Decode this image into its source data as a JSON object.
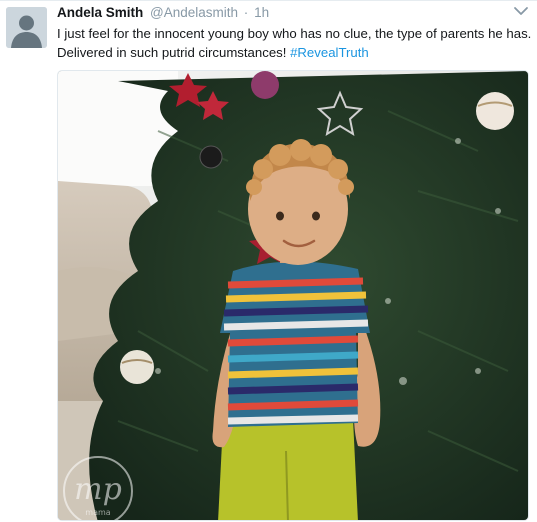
{
  "tweet": {
    "author_name": "Andela Smith",
    "handle": "@Andelasmith",
    "separator": "·",
    "time": "1h",
    "text_before": "I just feel for the innocent young boy who has no clue, the type of parents he has. Delivered in such putrid circumstances! ",
    "hashtag": "#RevealTruth"
  },
  "watermark": {
    "text_main": "mp",
    "text_sub": "mama"
  },
  "icons": {
    "avatar": "default-avatar-icon",
    "caret": "chevron-down-icon"
  },
  "colors": {
    "name": "#14171a",
    "muted": "#8899a6",
    "hashtag": "#1b95e0",
    "tree_green": "#1f3a24"
  }
}
